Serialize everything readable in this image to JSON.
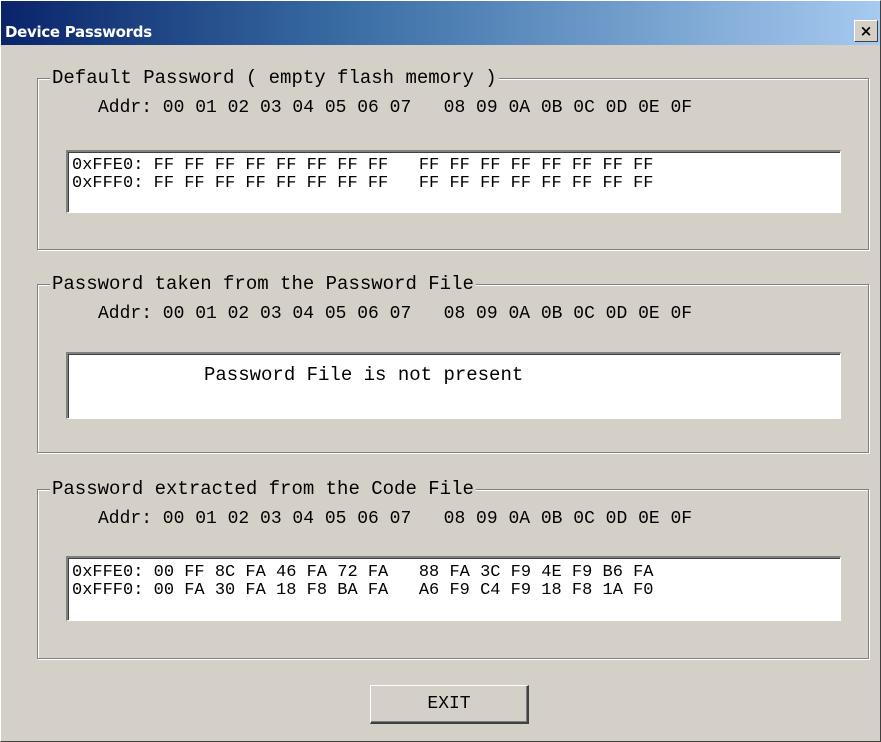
{
  "window": {
    "title": "Device Passwords",
    "close_glyph": "×"
  },
  "groups": {
    "default": {
      "title": "Default Password ( empty flash memory )",
      "addr_header": "Addr: 00 01 02 03 04 05 06 07   08 09 0A 0B 0C 0D 0E 0F",
      "rows": [
        "0xFFE0: FF FF FF FF FF FF FF FF   FF FF FF FF FF FF FF FF",
        "0xFFF0: FF FF FF FF FF FF FF FF   FF FF FF FF FF FF FF FF"
      ]
    },
    "password_file": {
      "title": "Password taken from the Password File",
      "addr_header": "Addr: 00 01 02 03 04 05 06 07   08 09 0A 0B 0C 0D 0E 0F",
      "message": "Password File is not present"
    },
    "code_file": {
      "title": "Password extracted from the Code File",
      "addr_header": "Addr: 00 01 02 03 04 05 06 07   08 09 0A 0B 0C 0D 0E 0F",
      "rows": [
        "0xFFE0: 00 FF 8C FA 46 FA 72 FA   88 FA 3C F9 4E F9 B6 FA",
        "0xFFF0: 00 FA 30 FA 18 F8 BA FA   A6 F9 C4 F9 18 F8 1A F0"
      ]
    }
  },
  "buttons": {
    "exit_label": "EXIT"
  }
}
